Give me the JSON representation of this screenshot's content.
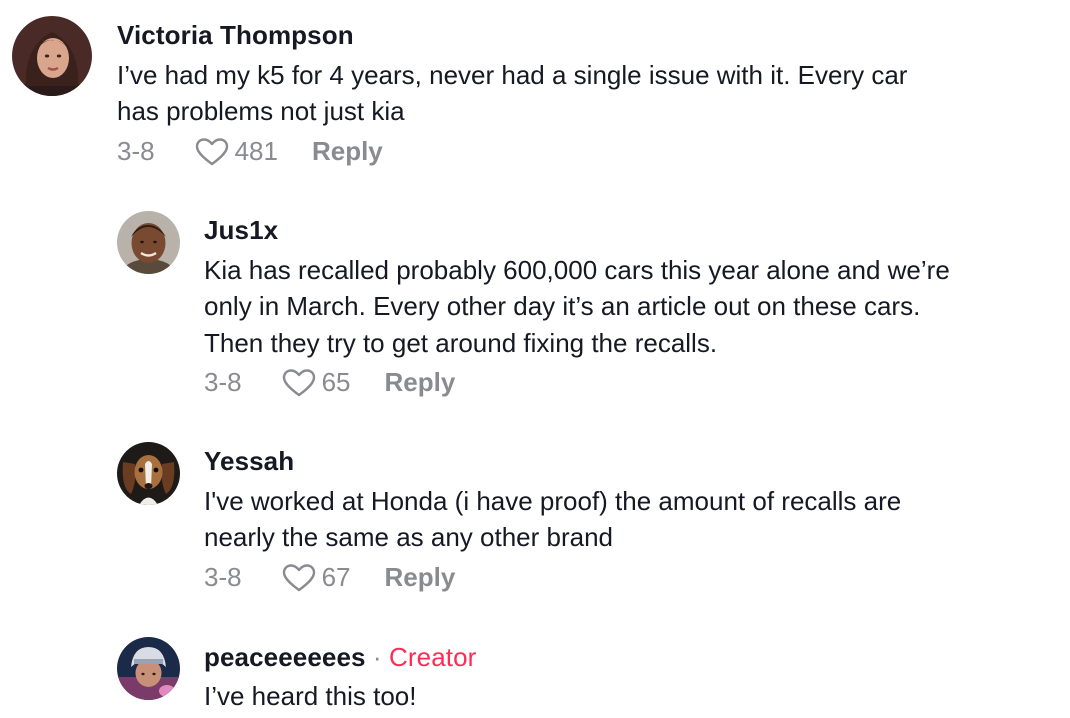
{
  "comments": [
    {
      "username": "Victoria Thompson",
      "lines": [
        "I’ve had my k5 for 4 years, never had a single issue with it. Every car",
        "has problems not just kia"
      ],
      "date": "3-8",
      "likes": "481",
      "reply_label": "Reply"
    },
    {
      "username": "Jus1x",
      "lines": [
        "Kia has recalled probably 600,000 cars this year alone and we’re",
        "only in March. Every other day it’s an article out on these cars.",
        "Then they try to get around fixing the recalls."
      ],
      "date": "3-8",
      "likes": "65",
      "reply_label": "Reply"
    },
    {
      "username": "Yessah",
      "lines": [
        "I've worked at Honda (i have proof) the amount of recalls are",
        "nearly the same as any other brand"
      ],
      "date": "3-8",
      "likes": "67",
      "reply_label": "Reply"
    },
    {
      "username": "peaceeeeees",
      "creator_separator": "·",
      "creator_label": "Creator",
      "lines": [
        "I’ve heard this too!"
      ]
    }
  ],
  "icons": {
    "like": "heart-outline-icon"
  },
  "colors": {
    "creator": "#fe2c55",
    "meta": "#8a8b91",
    "text": "#161823"
  }
}
